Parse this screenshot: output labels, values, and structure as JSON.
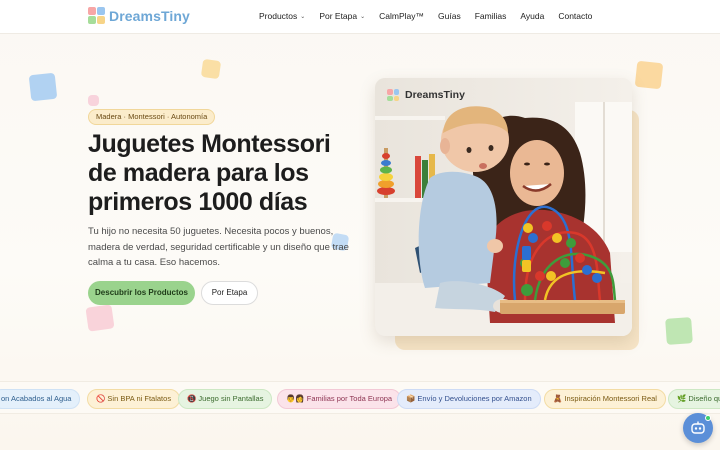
{
  "brand": {
    "name": "DreamsTiny",
    "colors": [
      "#f7a6a6",
      "#9bc6ef",
      "#a6dd9a",
      "#f7d488"
    ]
  },
  "nav": {
    "items": [
      {
        "label": "Productos",
        "has_dropdown": true
      },
      {
        "label": "Por Etapa",
        "has_dropdown": true
      },
      {
        "label": "CalmPlay™",
        "has_dropdown": false
      },
      {
        "label": "Guías",
        "has_dropdown": false
      },
      {
        "label": "Familias",
        "has_dropdown": false
      },
      {
        "label": "Ayuda",
        "has_dropdown": false
      },
      {
        "label": "Contacto",
        "has_dropdown": false
      }
    ],
    "chevron": "⌄"
  },
  "hero": {
    "badge": "Madera · Montessori · Autonomía",
    "title": "Juguetes Montessori de madera para los primeros 1000 días",
    "subtitle": "Tu hijo no necesita 50 juguetes. Necesita pocos y buenos, madera de verdad, seguridad certificable y un diseño que trae calma a tu casa. Eso hacemos.",
    "primary_cta": "Descubrir los Productos",
    "secondary_cta": "Por Etapa",
    "image_alt": "Madre y bebé jugando con un laberinto de cuentas de madera",
    "image_logo": "DreamsTiny"
  },
  "strip": {
    "pills": [
      {
        "label": "on Acabados al Agua",
        "bg": "#e4f0fb",
        "border": "#cfe2f5",
        "color": "#2f5f8e"
      },
      {
        "label": "🚫 Sin BPA ni Ftalatos",
        "bg": "#fdf1d6",
        "border": "#f3dca4",
        "color": "#7a5a12"
      },
      {
        "label": "📵 Juego sin Pantallas",
        "bg": "#e6f4e1",
        "border": "#cde8c4",
        "color": "#3b6b2e"
      },
      {
        "label": "👨‍👩 Familias por Toda Europa",
        "bg": "#fbe3ea",
        "border": "#f3c9d6",
        "color": "#8e3553"
      },
      {
        "label": "📦 Envío y Devoluciones por Amazon",
        "bg": "#e4ecfb",
        "border": "#cddbf5",
        "color": "#34508e"
      },
      {
        "label": "🧸 Inspiración Montessori Real",
        "bg": "#fdf1d6",
        "border": "#f3dca4",
        "color": "#7a5a12"
      },
      {
        "label": "🌿 Diseño que",
        "bg": "#e6f4e1",
        "border": "#cde8c4",
        "color": "#3b6b2e"
      }
    ]
  },
  "chat": {
    "icon": "robot-icon"
  }
}
